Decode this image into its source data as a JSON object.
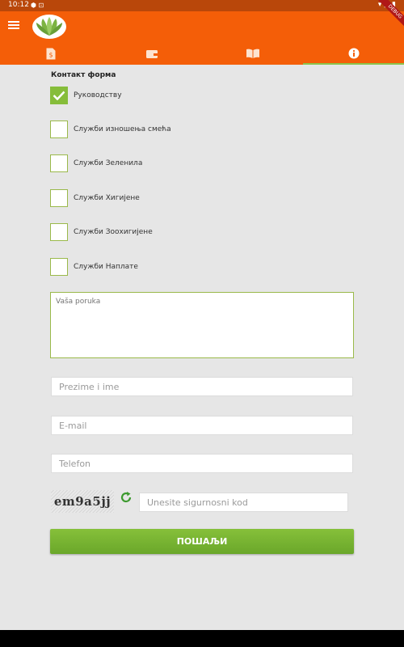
{
  "status_bar": {
    "time": "10:12",
    "icons_left": "⬢ ⊡",
    "icons_right": "▾ ◢ ▮"
  },
  "app_bar": {
    "debug_label": "DEBUG"
  },
  "tabs": [
    {
      "name": "payments",
      "icon": "dollar-document-icon"
    },
    {
      "name": "wallet",
      "icon": "wallet-icon"
    },
    {
      "name": "book",
      "icon": "book-icon"
    },
    {
      "name": "info",
      "icon": "info-icon",
      "active": true
    }
  ],
  "form": {
    "title": "Контакт форма",
    "checkboxes": [
      {
        "label": "Руководству",
        "checked": true
      },
      {
        "label": "Служби изношења смећа",
        "checked": false
      },
      {
        "label": "Служби Зеленила",
        "checked": false
      },
      {
        "label": "Служби Хигијене",
        "checked": false
      },
      {
        "label": "Служби Зоохигијене",
        "checked": false
      },
      {
        "label": "Служби Наплате",
        "checked": false
      }
    ],
    "message_placeholder": "Vaša poruka",
    "name_placeholder": "Prezime i ime",
    "email_placeholder": "E-mail",
    "phone_placeholder": "Telefon",
    "captcha_text": "em9a5jj",
    "captcha_placeholder": "Unesite sigurnosni kod",
    "submit_label": "ПОШАЉИ"
  },
  "colors": {
    "primary": "#f45e08",
    "accent": "#86bd3a",
    "status_bar": "#b9470a"
  }
}
